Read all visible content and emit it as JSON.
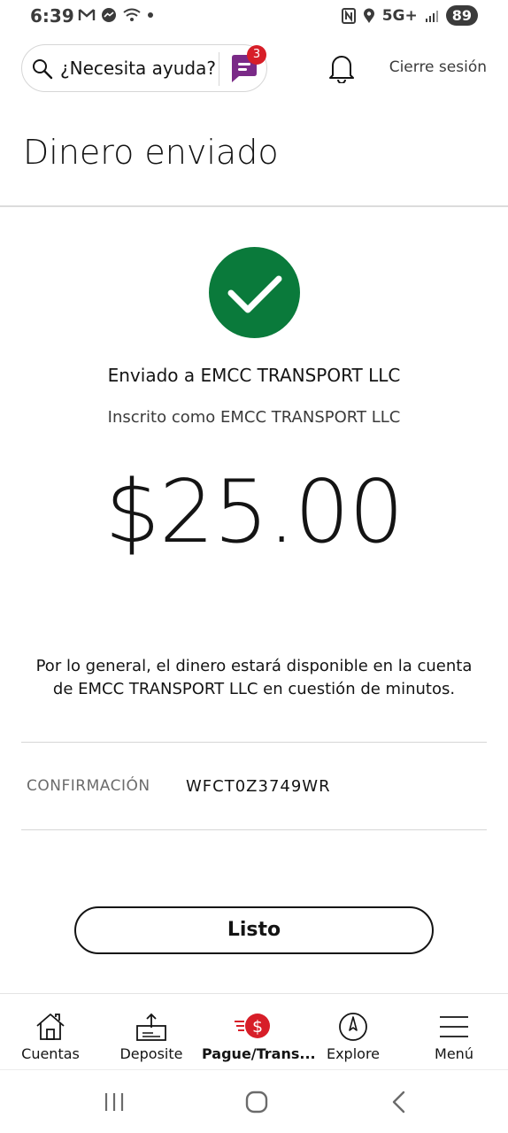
{
  "status_bar": {
    "time": "6:39",
    "network": "5G+",
    "battery": "89"
  },
  "header": {
    "search_label": "¿Necesita ayuda?",
    "chat_badge": "3",
    "signout_label": "Cierre sesión"
  },
  "page": {
    "title": "Dinero enviado"
  },
  "confirmation": {
    "sent_to": "Enviado a EMCC TRANSPORT LLC",
    "enrolled_as": "Inscrito como EMCC TRANSPORT LLC",
    "amount": "$25.00",
    "availability": "Por lo general, el dinero estará disponible en la cuenta de EMCC TRANSPORT LLC en cuestión de minutos.",
    "confirmation_label": "CONFIRMACIÓN",
    "confirmation_code": "WFCT0Z3749WR",
    "done_label": "Listo"
  },
  "bottom_nav": {
    "items": [
      {
        "label": "Cuentas",
        "icon": "home-icon"
      },
      {
        "label": "Deposite",
        "icon": "deposit-icon"
      },
      {
        "label": "Pague/Trans...",
        "icon": "pay-transfer-icon"
      },
      {
        "label": "Explore",
        "icon": "compass-icon"
      },
      {
        "label": "Menú",
        "icon": "menu-icon"
      }
    ],
    "active_index": 2
  },
  "colors": {
    "success_green": "#0a7a3b",
    "brand_red": "#d71e28",
    "chat_purple": "#7a2a87"
  }
}
